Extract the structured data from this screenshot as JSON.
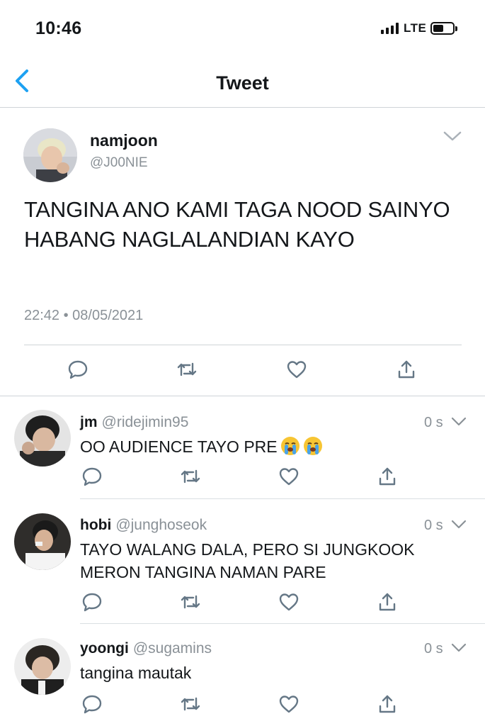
{
  "status_bar": {
    "time": "10:46",
    "network": "LTE"
  },
  "nav": {
    "title": "Tweet"
  },
  "main_tweet": {
    "name": "namjoon",
    "handle": "@J00NIE",
    "text": "TANGINA ANO KAMI TAGA NOOD SAINYO HABANG NAGLALANDIAN KAYO",
    "timestamp": "22:42 • 08/05/2021"
  },
  "replies": [
    {
      "name": "jm",
      "handle": "@ridejimin95",
      "time": "0 s",
      "text": "OO AUDIENCE TAYO PRE",
      "emojis": [
        "loudly-crying-face-emoji",
        "loudly-crying-face-emoji"
      ]
    },
    {
      "name": "hobi",
      "handle": "@junghoseok",
      "time": "0 s",
      "text": "TAYO WALANG DALA, PERO SI JUNGKOOK MERON TANGINA NAMAN PARE"
    },
    {
      "name": "yoongi",
      "handle": "@sugamins",
      "time": "0 s",
      "text": "tangina mautak"
    }
  ],
  "icons": {
    "back": "chevron-left-icon",
    "menu": "chevron-down-icon",
    "reply": "reply-bubble-icon",
    "retweet": "retweet-icon",
    "like": "heart-icon",
    "share": "share-icon"
  },
  "colors": {
    "accent": "#1da1f2",
    "secondary_text": "#8a9197",
    "icon": "#657786",
    "divider": "#cfd4d8"
  }
}
